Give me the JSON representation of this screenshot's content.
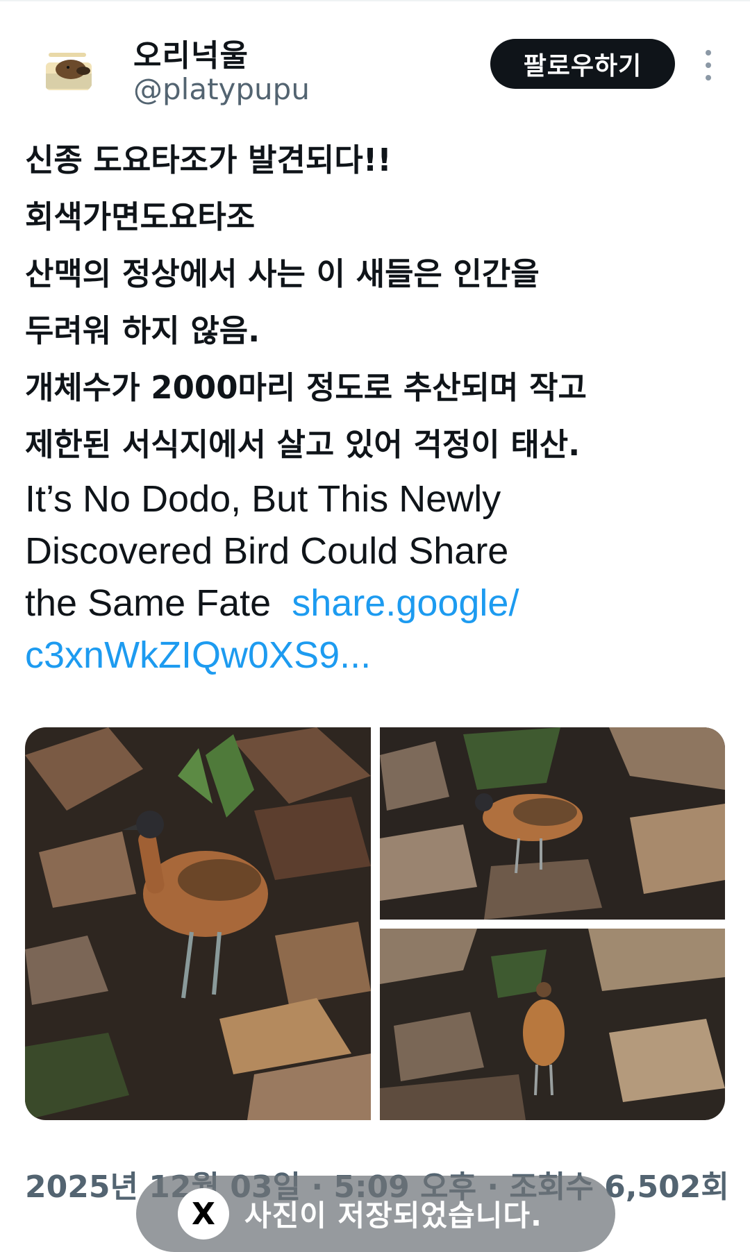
{
  "user": {
    "display_name": "오리넉울",
    "handle": "@platypupu",
    "avatar_icon": "platypus-avatar"
  },
  "follow_button": {
    "label": "팔로우하기"
  },
  "more_button": {
    "icon": "more-vertical-icon"
  },
  "tweet": {
    "korean_lines": [
      "신종 도요타조가 발견되다!!",
      "회색가면도요타조",
      "산맥의 정상에서 사는 이 새들은 인간을",
      "두려워 하지 않음.",
      "개체수가 2000마리 정도로 추산되며 작고",
      "제한된 서식지에서 살고 있어 걱정이 태산."
    ],
    "english_lines": [
      "It’s No Dodo, But This Newly",
      "Discovered Bird Could Share",
      "the Same Fate"
    ],
    "link_part1": "share.google/",
    "link_part2": "c3xnWkZIQw0XS9..."
  },
  "media": {
    "photo_count": 3
  },
  "meta": {
    "timestamp": "2025년 12월 03일 · 5:09 오후 · 조회수 6,502회"
  },
  "toast": {
    "icon": "x-logo-icon",
    "icon_glyph": "X",
    "message": "사진이 저장되었습니다."
  },
  "colors": {
    "link": "#1d9bf0",
    "secondary_text": "#536471",
    "follow_bg": "#0f1419"
  }
}
